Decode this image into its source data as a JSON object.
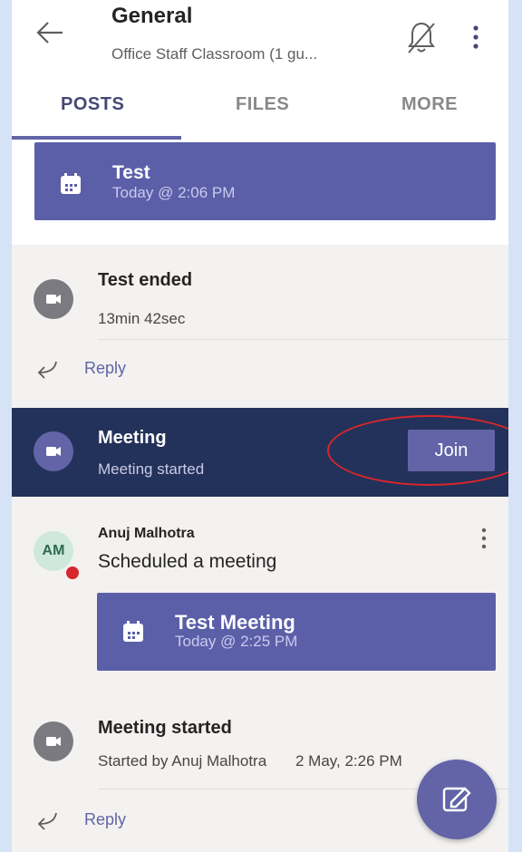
{
  "header": {
    "title": "General",
    "subtitle": "Office Staff Classroom (1 gu...",
    "tabs": [
      "POSTS",
      "FILES",
      "MORE"
    ]
  },
  "top_event": {
    "title": "Test",
    "time": "Today @ 2:06 PM"
  },
  "test_ended": {
    "title": "Test ended",
    "duration": "13min 42sec",
    "reply": "Reply"
  },
  "meeting_bar": {
    "title": "Meeting",
    "status": "Meeting started",
    "join": "Join"
  },
  "post": {
    "avatar_initials": "AM",
    "author": "Anuj Malhotra",
    "text": "Scheduled a meeting",
    "event": {
      "title": "Test Meeting",
      "time": "Today @ 2:25 PM"
    },
    "started": {
      "title": "Meeting started",
      "by": "Started by Anuj Malhotra",
      "time": "2 May, 2:26 PM"
    },
    "reply": "Reply"
  },
  "colors": {
    "accent": "#6264a7",
    "meeting_bar": "#23325a",
    "annotation": "#d7262c"
  }
}
